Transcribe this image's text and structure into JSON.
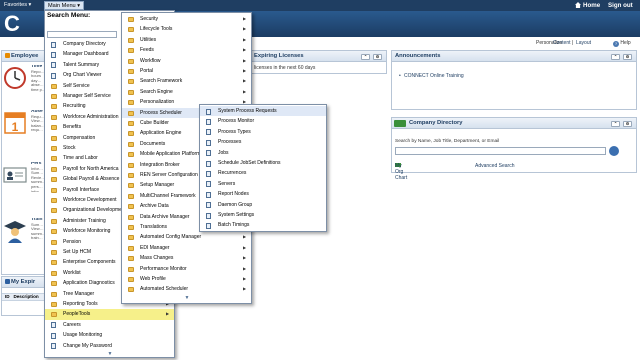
{
  "topbar": {
    "favorites": "Favorites ▾",
    "main_menu": "Main Menu ▾",
    "home": "Home",
    "signout": "Sign out"
  },
  "banner": {
    "logo_letter": "C"
  },
  "personalize": {
    "text": "Personalize",
    "content": "Content",
    "sep": "|",
    "layout": "Layout",
    "help": "Help"
  },
  "left": {
    "employee_title": "Employee",
    "tiles": [
      {
        "title": "Time",
        "lines": "Repo…\nhours\nday…\nabse…\ntime p…"
      },
      {
        "title": "Abse",
        "lines": "Requ…\nView…\nbalan…\nrequ…"
      },
      {
        "title": "Pers",
        "lines": "Infor…\nSum…\nRevie…\nsumm…\npers…\ninfor…"
      },
      {
        "title": "Train",
        "lines": "Sum…\nView…\nsumm…\ntrain…"
      }
    ],
    "expiring_title": "My Expir",
    "id_header": "ID",
    "desc_header": "Description"
  },
  "center": {
    "title": "Expiring Licenses",
    "line": "licenses in the next 60 days"
  },
  "announcements": {
    "title": "Announcements",
    "item": "CONNECT Online Training"
  },
  "directory": {
    "title": "Company Directory",
    "label": "Search by Name, Job Title, Department, or Email",
    "link_org": "My Org Chart",
    "link_adv": "Advanced Search"
  },
  "menu1": {
    "title": "Search Menu:",
    "items": [
      {
        "label": "Company Directory",
        "type": "doc",
        "arrow": false
      },
      {
        "label": "Manager Dashboard",
        "type": "doc",
        "arrow": false
      },
      {
        "label": "Talent Summary",
        "type": "doc",
        "arrow": false
      },
      {
        "label": "Org Chart Viewer",
        "type": "doc",
        "arrow": false
      },
      {
        "label": "Self Service",
        "type": "folder",
        "arrow": true
      },
      {
        "label": "Manager Self Service",
        "type": "folder",
        "arrow": true
      },
      {
        "label": "Recruiting",
        "type": "folder",
        "arrow": true
      },
      {
        "label": "Workforce Administration",
        "type": "folder",
        "arrow": true
      },
      {
        "label": "Benefits",
        "type": "folder",
        "arrow": true
      },
      {
        "label": "Compensation",
        "type": "folder",
        "arrow": true
      },
      {
        "label": "Stock",
        "type": "folder",
        "arrow": true
      },
      {
        "label": "Time and Labor",
        "type": "folder",
        "arrow": true
      },
      {
        "label": "Payroll for North America",
        "type": "folder",
        "arrow": true
      },
      {
        "label": "Global Payroll & Absence Mgmt",
        "type": "folder",
        "arrow": true
      },
      {
        "label": "Payroll Interface",
        "type": "folder",
        "arrow": true
      },
      {
        "label": "Workforce Development",
        "type": "folder",
        "arrow": true
      },
      {
        "label": "Organizational Development",
        "type": "folder",
        "arrow": true
      },
      {
        "label": "Administer Training",
        "type": "folder",
        "arrow": true
      },
      {
        "label": "Workforce Monitoring",
        "type": "folder",
        "arrow": true
      },
      {
        "label": "Pension",
        "type": "folder",
        "arrow": true
      },
      {
        "label": "Set Up HCM",
        "type": "folder",
        "arrow": true
      },
      {
        "label": "Enterprise Components",
        "type": "folder",
        "arrow": true
      },
      {
        "label": "Worklist",
        "type": "folder",
        "arrow": true
      },
      {
        "label": "Application Diagnostics",
        "type": "folder",
        "arrow": true
      },
      {
        "label": "Tree Manager",
        "type": "folder",
        "arrow": true
      },
      {
        "label": "Reporting Tools",
        "type": "folder",
        "arrow": true
      },
      {
        "label": "PeopleTools",
        "type": "folder",
        "arrow": true
      },
      {
        "label": "Careers",
        "type": "doc",
        "arrow": false
      },
      {
        "label": "Usage Monitoring",
        "type": "doc",
        "arrow": false
      },
      {
        "label": "Change My Password",
        "type": "doc",
        "arrow": false
      }
    ]
  },
  "menu2": {
    "items": [
      {
        "label": "Security",
        "type": "folder"
      },
      {
        "label": "Lifecycle Tools",
        "type": "folder"
      },
      {
        "label": "Utilities",
        "type": "folder"
      },
      {
        "label": "Feeds",
        "type": "folder"
      },
      {
        "label": "Workflow",
        "type": "folder"
      },
      {
        "label": "Portal",
        "type": "folder"
      },
      {
        "label": "Search Framework",
        "type": "folder"
      },
      {
        "label": "Search Engine",
        "type": "folder"
      },
      {
        "label": "Personalization",
        "type": "folder"
      },
      {
        "label": "Process Scheduler",
        "type": "folder"
      },
      {
        "label": "Cube Builder",
        "type": "folder"
      },
      {
        "label": "Application Engine",
        "type": "folder"
      },
      {
        "label": "Documents",
        "type": "folder"
      },
      {
        "label": "Mobile Application Platform",
        "type": "folder"
      },
      {
        "label": "Integration Broker",
        "type": "folder"
      },
      {
        "label": "REN Server Configuration",
        "type": "folder"
      },
      {
        "label": "Setup Manager",
        "type": "folder"
      },
      {
        "label": "MultiChannel Framework",
        "type": "folder"
      },
      {
        "label": "Archive Data",
        "type": "folder"
      },
      {
        "label": "Data Archive Manager",
        "type": "folder"
      },
      {
        "label": "Translations",
        "type": "folder"
      },
      {
        "label": "Automated Config Manager",
        "type": "folder"
      },
      {
        "label": "EDI Manager",
        "type": "folder"
      },
      {
        "label": "Mass Changes",
        "type": "folder"
      },
      {
        "label": "Performance Monitor",
        "type": "folder"
      },
      {
        "label": "Web Profile",
        "type": "folder"
      },
      {
        "label": "Automated Scheduler",
        "type": "folder"
      }
    ]
  },
  "menu3": {
    "items": [
      {
        "label": "System Process Requests"
      },
      {
        "label": "Process Monitor"
      },
      {
        "label": "Process Types"
      },
      {
        "label": "Processes"
      },
      {
        "label": "Jobs"
      },
      {
        "label": "Schedule JobSet Definitions"
      },
      {
        "label": "Recurrences"
      },
      {
        "label": "Servers"
      },
      {
        "label": "Report Nodes"
      },
      {
        "label": "Daemon Group"
      },
      {
        "label": "System Settings"
      },
      {
        "label": "Batch Timings"
      }
    ]
  },
  "colors": {
    "nav_bar": "#1f3e62",
    "highlight": "#f6f08a",
    "hover": "#dfe8f6",
    "folder": "#f0c250"
  }
}
